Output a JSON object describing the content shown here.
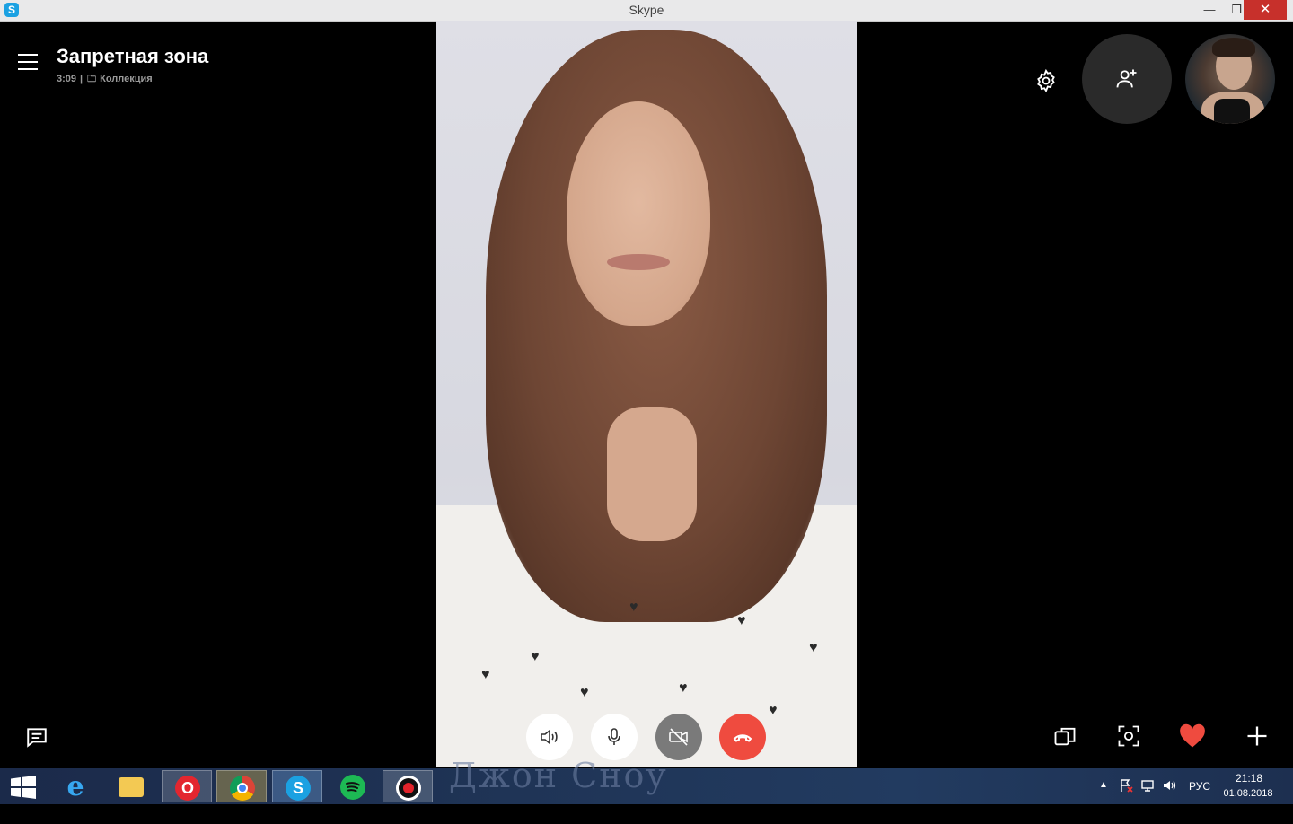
{
  "window": {
    "title": "Skype",
    "app_icon": "S",
    "minimize": "—",
    "maximize": "❐",
    "close": "✕"
  },
  "conversation": {
    "title": "Запретная зона",
    "duration": "3:09",
    "separator": "|",
    "group_label": "Коллекция"
  },
  "icons": {
    "menu": "hamburger-icon",
    "settings": "gear-icon",
    "add_participant": "add-person-icon",
    "chat": "chat-icon",
    "speaker": "speaker-icon",
    "mic": "microphone-icon",
    "video_off": "video-off-icon",
    "hangup": "hangup-icon",
    "switch_camera": "switch-camera-icon",
    "snapshot": "snapshot-icon",
    "heart": "heart-icon",
    "plus": "plus-icon"
  },
  "colors": {
    "hangup": "#ef4b3f",
    "heart": "#ef4b3f",
    "video_off_bg": "#7a7a7a",
    "close_btn": "#c7302b"
  },
  "overlay_text": "Джон Сноу",
  "taskbar": {
    "apps": [
      {
        "name": "internet-explorer",
        "glyph": "e"
      },
      {
        "name": "file-explorer",
        "glyph": ""
      },
      {
        "name": "opera",
        "glyph": "O"
      },
      {
        "name": "chrome",
        "glyph": ""
      },
      {
        "name": "skype",
        "glyph": "S"
      },
      {
        "name": "spotify",
        "glyph": ""
      },
      {
        "name": "recorder",
        "glyph": ""
      }
    ],
    "tray": {
      "arrow": "▲",
      "language": "РУС",
      "time": "21:18",
      "date": "01.08.2018"
    }
  }
}
